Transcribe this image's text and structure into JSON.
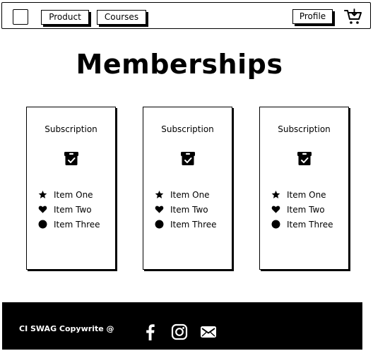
{
  "nav": {
    "logo_icon": "square-logo-icon",
    "product_label": "Product",
    "courses_label": "Courses",
    "profile_label": "Profile",
    "cart_icon": "cart-icon"
  },
  "page": {
    "title": "Memberships"
  },
  "cards": [
    {
      "title": "Subscription",
      "icon": "box-check-icon",
      "features": [
        {
          "icon": "star-icon",
          "label": "Item One"
        },
        {
          "icon": "heart-icon",
          "label": "Item Two"
        },
        {
          "icon": "circle-icon",
          "label": "Item Three"
        }
      ]
    },
    {
      "title": "Subscription",
      "icon": "box-check-icon",
      "features": [
        {
          "icon": "star-icon",
          "label": "Item One"
        },
        {
          "icon": "heart-icon",
          "label": "Item Two"
        },
        {
          "icon": "circle-icon",
          "label": "Item Three"
        }
      ]
    },
    {
      "title": "Subscription",
      "icon": "box-check-icon",
      "features": [
        {
          "icon": "star-icon",
          "label": "Item One"
        },
        {
          "icon": "heart-icon",
          "label": "Item Two"
        },
        {
          "icon": "circle-icon",
          "label": "Item Three"
        }
      ]
    }
  ],
  "footer": {
    "copyright": "CI SWAG Copywrite @",
    "social": [
      "facebook-icon",
      "instagram-icon",
      "email-icon"
    ],
    "background": "#000000",
    "text_color": "#ffffff"
  }
}
